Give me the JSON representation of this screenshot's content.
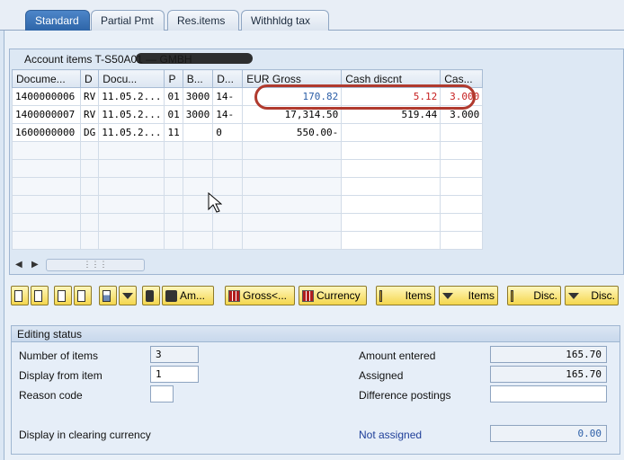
{
  "tabs": [
    {
      "label": "Standard"
    },
    {
      "label": "Partial Pmt"
    },
    {
      "label": "Res.items"
    },
    {
      "label": "Withhldg tax"
    }
  ],
  "account_items": {
    "title": "Account items T-S50A01 — GMBH",
    "columns": [
      "Docume...",
      "D",
      "Docu...",
      "P",
      "B...",
      "D...",
      "EUR Gross",
      "Cash discnt",
      "Cas..."
    ],
    "rows": [
      [
        "1400000006",
        "RV",
        "11.05.2...",
        "01",
        "3000",
        "14-",
        "170.82",
        "5.12",
        "3.000"
      ],
      [
        "1400000007",
        "RV",
        "11.05.2...",
        "01",
        "3000",
        "14-",
        "17,314.50",
        "519.44",
        "3.000"
      ],
      [
        "1600000000",
        "DG",
        "11.05.2...",
        "11",
        "",
        "0",
        "550.00-",
        "",
        ""
      ]
    ]
  },
  "toolbar": {
    "amount_label": "Am...",
    "gross_label": "Gross<...",
    "currency_label": "Currency",
    "items_label_1": "Items",
    "items_label_2": "Items",
    "disc_label_1": "Disc.",
    "disc_label_2": "Disc."
  },
  "editing": {
    "title": "Editing status",
    "number_of_items_label": "Number of items",
    "number_of_items": "3",
    "display_from_label": "Display from item",
    "display_from": "1",
    "reason_code_label": "Reason code",
    "reason_code": "",
    "display_clearing_label": "Display in clearing currency",
    "amount_entered_label": "Amount entered",
    "amount_entered": "165.70",
    "assigned_label": "Assigned",
    "assigned": "165.70",
    "difference_label": "Difference postings",
    "difference": "",
    "not_assigned_label": "Not assigned",
    "not_assigned": "0.00"
  }
}
